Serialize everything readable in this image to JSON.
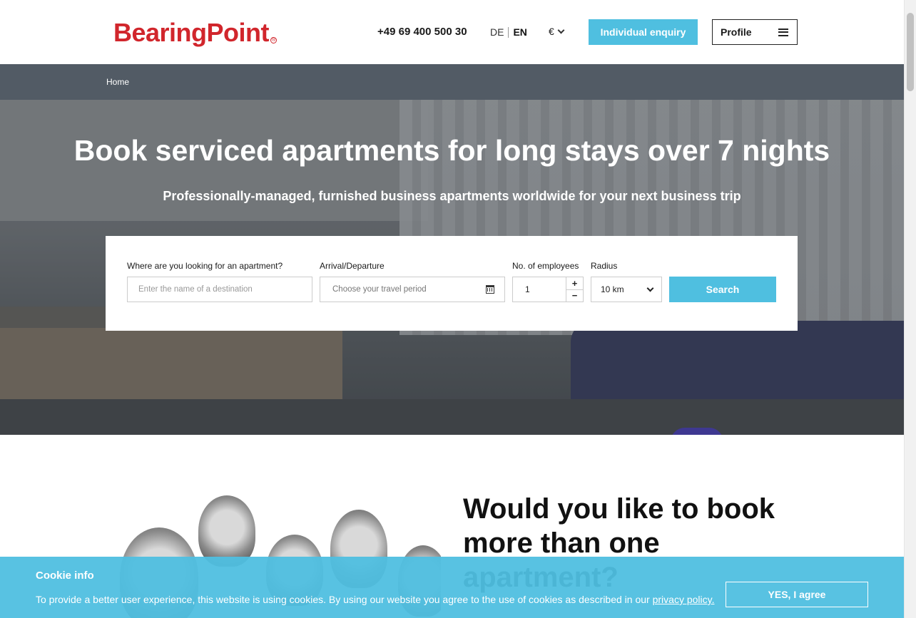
{
  "header": {
    "logo_text": "BearingPoint",
    "logo_mark": "®",
    "phone": "+49 69 400 500 30",
    "lang_de": "DE",
    "lang_en": "EN",
    "currency": "€",
    "enquiry_label": "Individual enquiry",
    "profile_label": "Profile",
    "brand_color": "#d1262c",
    "accent_color": "#4fbfe0"
  },
  "breadcrumb": {
    "home": "Home"
  },
  "hero": {
    "title": "Book serviced apartments for long stays over 7 nights",
    "subtitle": "Professionally-managed, furnished business apartments worldwide for your next business trip"
  },
  "search": {
    "destination_label": "Where are you looking for an apartment?",
    "destination_placeholder": "Enter the name of a destination",
    "dates_label": "Arrival/Departure",
    "dates_placeholder": "Choose your travel period",
    "employees_label": "No. of employees",
    "employees_value": "1",
    "plus": "+",
    "minus": "−",
    "radius_label": "Radius",
    "radius_value": "10 km",
    "search_label": "Search"
  },
  "section": {
    "title": "Would you like to book more than one apartment?"
  },
  "cookie": {
    "title": "Cookie info",
    "text": "To provide a better user experience, this website is using cookies. By using our website you agree to the use of cookies as described in our ",
    "link": "privacy policy.",
    "accept_label": "YES, I agree"
  }
}
